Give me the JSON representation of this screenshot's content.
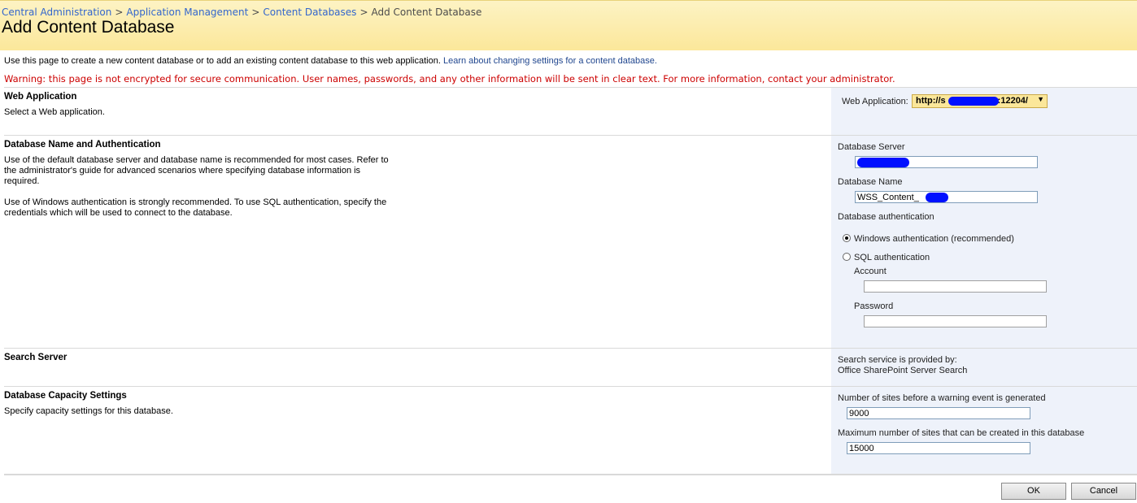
{
  "breadcrumb": {
    "items": [
      "Central Administration",
      "Application Management",
      "Content Databases"
    ],
    "separator": ">",
    "current": "Add Content Database"
  },
  "page_title": "Add Content Database",
  "intro": {
    "text": "Use this page to create a new content database or to add an existing content database to this web application.",
    "link": "Learn about changing settings for a content database."
  },
  "warning": "Warning: this page is not encrypted for secure communication. User names, passwords, and any other information will be sent in clear text. For more information, contact your administrator.",
  "web_application": {
    "title": "Web Application",
    "description": "Select a Web application.",
    "label": "Web Application:",
    "value_prefix": "http://s",
    "value_suffix": ":12204/"
  },
  "database": {
    "title": "Database Name and Authentication",
    "description1": "Use of the default database server and database name is recommended for most cases. Refer to the administrator's guide for advanced scenarios where specifying database information is required.",
    "description2": "Use of Windows authentication is strongly recommended. To use SQL authentication, specify the credentials which will be used to connect to the database.",
    "server_label": "Database Server",
    "server_value": "",
    "name_label": "Database Name",
    "name_value": "WSS_Content_",
    "auth_label": "Database authentication",
    "windows_auth": "Windows authentication (recommended)",
    "sql_auth": "SQL authentication",
    "account_label": "Account",
    "account_value": "",
    "password_label": "Password",
    "password_value": ""
  },
  "search_server": {
    "title": "Search Server",
    "line1": "Search service is provided by:",
    "line2": "Office SharePoint Server Search"
  },
  "capacity": {
    "title": "Database Capacity Settings",
    "description": "Specify capacity settings for this database.",
    "warning_label": "Number of sites before a warning event is generated",
    "warning_value": "9000",
    "max_label": "Maximum number of sites that can be created in this database",
    "max_value": "15000"
  },
  "buttons": {
    "ok": "OK",
    "cancel": "Cancel"
  },
  "colors": {
    "header_bg": "#fbe79a",
    "warning": "#cc0000",
    "link": "#3366cc",
    "right_pane": "#eef2fa"
  }
}
